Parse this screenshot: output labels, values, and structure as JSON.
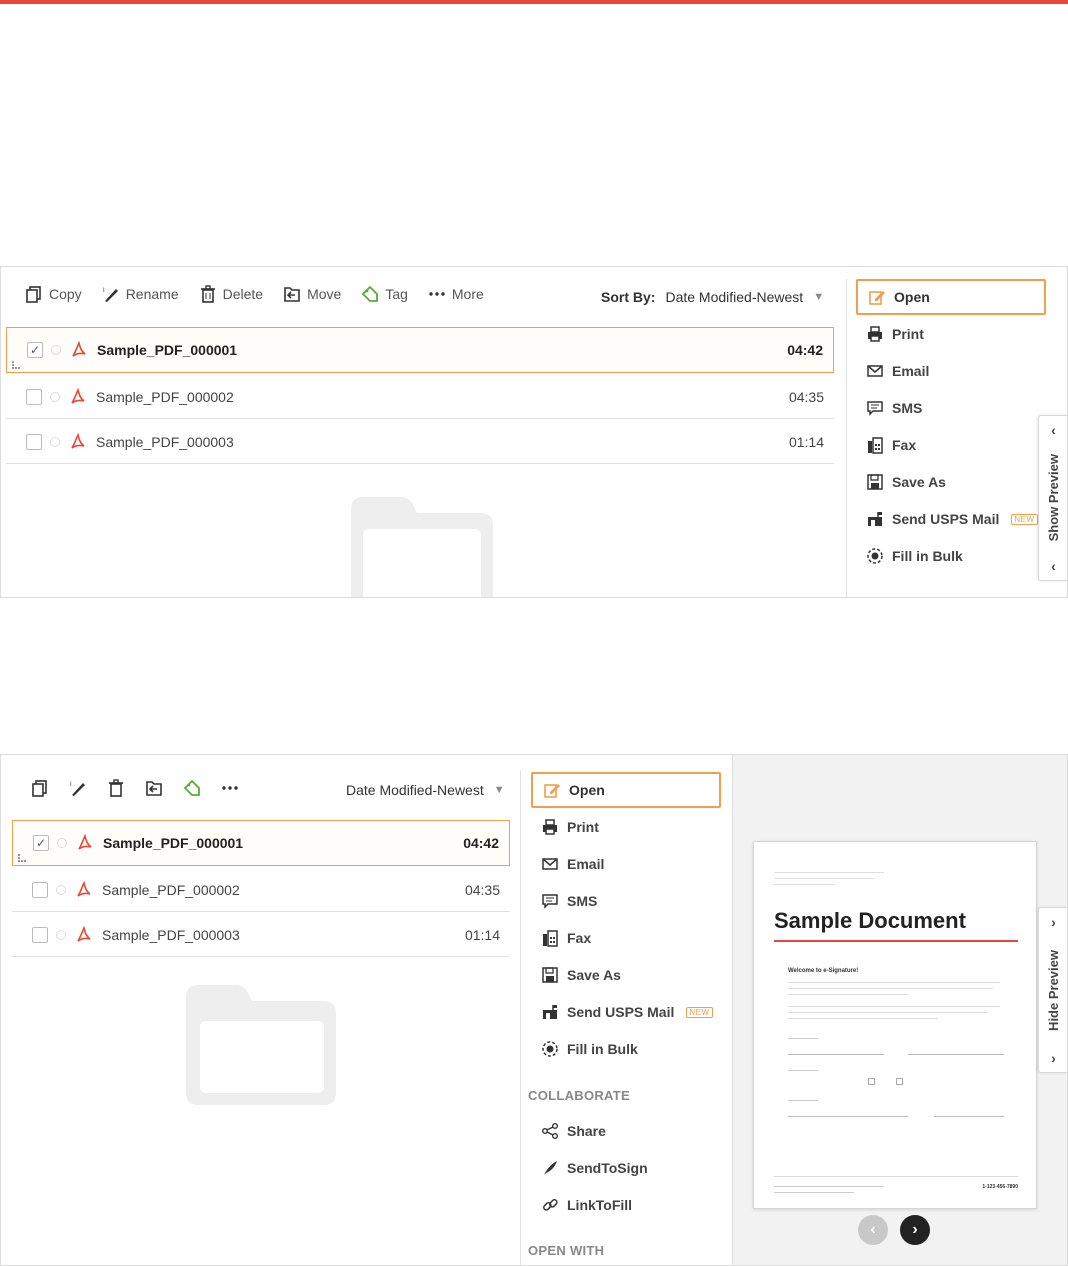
{
  "colors": {
    "accent": "#f0a04b",
    "brand_red": "#e8483b",
    "pdf_red": "#e8483b",
    "tag_green": "#5aaa3a"
  },
  "toolbar": {
    "copy": "Copy",
    "rename": "Rename",
    "delete": "Delete",
    "move": "Move",
    "tag": "Tag",
    "more": "More"
  },
  "sort": {
    "label": "Sort By:",
    "value": "Date Modified-Newest"
  },
  "files": [
    {
      "name": "Sample_PDF_000001",
      "time": "04:42",
      "checked": true
    },
    {
      "name": "Sample_PDF_000002",
      "time": "04:35",
      "checked": false
    },
    {
      "name": "Sample_PDF_000003",
      "time": "01:14",
      "checked": false
    }
  ],
  "checkmark": "✓",
  "actions": {
    "open": "Open",
    "print": "Print",
    "email": "Email",
    "sms": "SMS",
    "fax": "Fax",
    "save_as": "Save As",
    "send_usps": "Send USPS Mail",
    "new_badge": "NEW",
    "fill_in_bulk": "Fill in Bulk"
  },
  "collaborate": {
    "heading": "COLLABORATE",
    "share": "Share",
    "send_to_sign": "SendToSign",
    "link_to_fill": "LinkToFill"
  },
  "open_with": {
    "heading": "OPEN WITH"
  },
  "preview": {
    "show_label": "Show Preview",
    "hide_label": "Hide Preview",
    "doc_title": "Sample Document",
    "doc_heading": "Welcome to e-Signature!",
    "phone": "1-123-456-7890"
  }
}
